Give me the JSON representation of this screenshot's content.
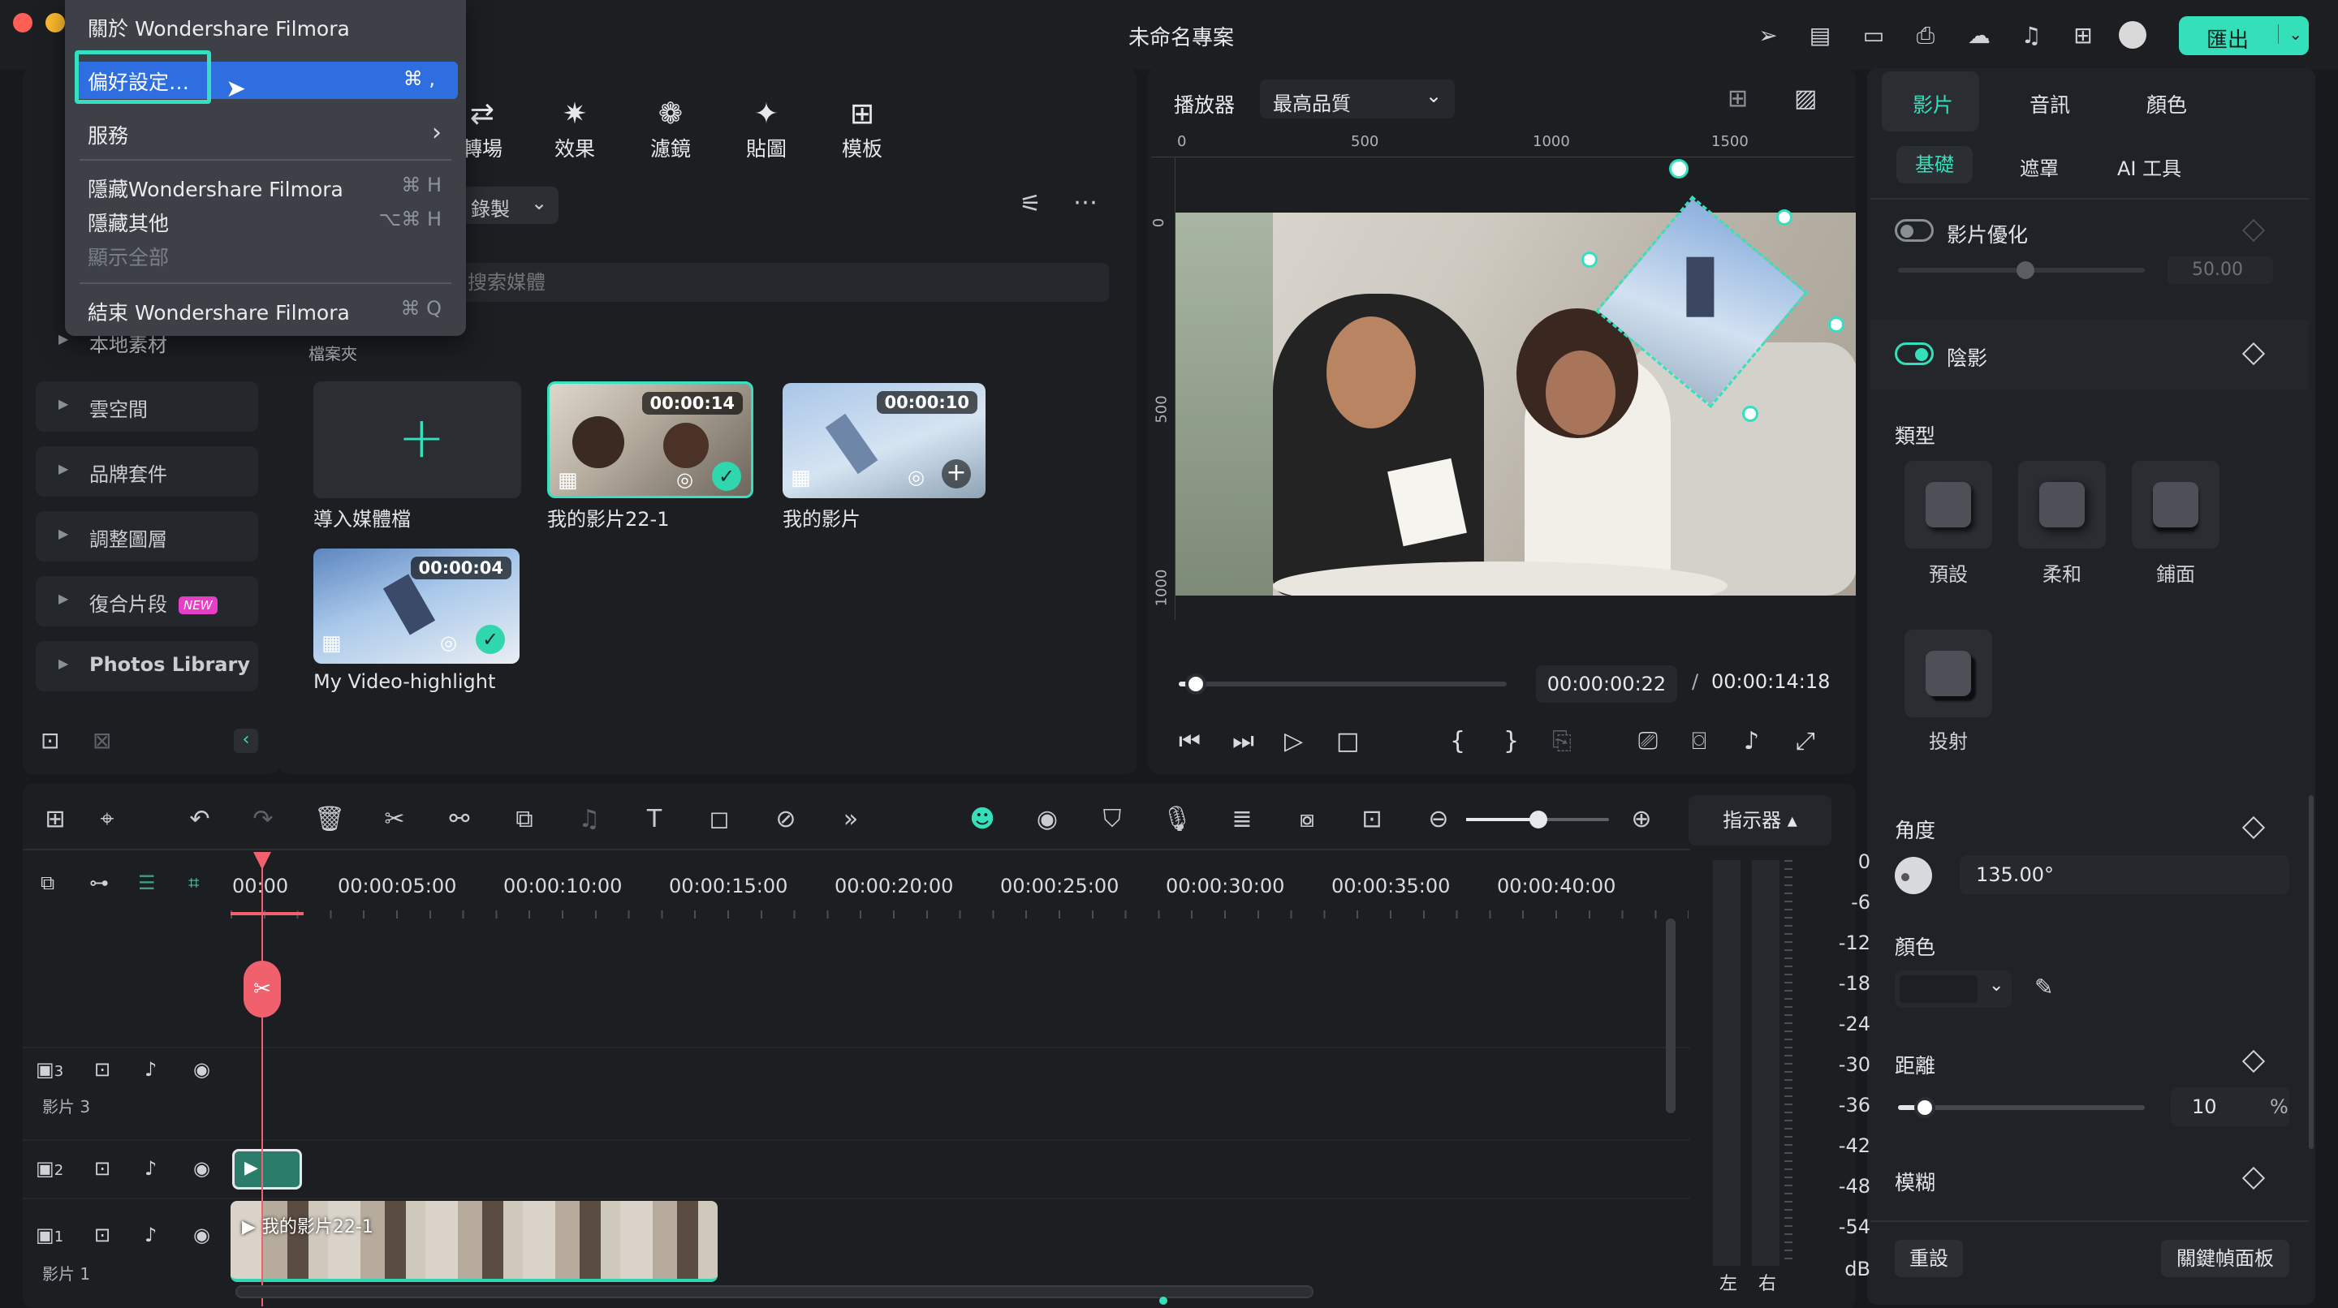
{
  "window": {
    "title": "未命名專案",
    "export_label": "匯出"
  },
  "menu": {
    "items": [
      {
        "label": "關於 Wondershare Filmora",
        "shortcut": ""
      },
      {
        "label": "偏好設定…",
        "shortcut": "⌘ ,"
      },
      {
        "label": "服務",
        "shortcut": "›"
      },
      {
        "label": "隱藏Wondershare Filmora",
        "shortcut": "⌘ H"
      },
      {
        "label": "隱藏其他",
        "shortcut": "⌥⌘ H"
      },
      {
        "label": "顯示全部",
        "shortcut": ""
      },
      {
        "label": "結束 Wondershare Filmora",
        "shortcut": "⌘ Q"
      }
    ]
  },
  "toolbar_tabs": [
    {
      "label": "轉場",
      "icon": "transition-icon"
    },
    {
      "label": "效果",
      "icon": "effects-icon"
    },
    {
      "label": "濾鏡",
      "icon": "filters-icon"
    },
    {
      "label": "貼圖",
      "icon": "stickers-icon"
    },
    {
      "label": "模板",
      "icon": "templates-icon"
    }
  ],
  "media": {
    "record_label": "錄製",
    "search_placeholder": "搜索媒體",
    "folder_label": "檔案夾",
    "import_label": "導入媒體檔",
    "clips": [
      {
        "name": "我的影片22-1",
        "duration": "00:00:14"
      },
      {
        "name": "我的影片",
        "duration": "00:00:10"
      },
      {
        "name": "My Video-highlight",
        "duration": "00:00:04"
      }
    ]
  },
  "sidebar": {
    "items": [
      {
        "label": "本地素材"
      },
      {
        "label": "雲空間"
      },
      {
        "label": "品牌套件"
      },
      {
        "label": "調整圖層"
      },
      {
        "label": "復合片段",
        "badge": "NEW"
      },
      {
        "label": "Photos Library"
      }
    ]
  },
  "player": {
    "label": "播放器",
    "quality": "最高品質",
    "ruler_h": [
      "0",
      "500",
      "1000",
      "1500"
    ],
    "ruler_v": [
      "0",
      "500",
      "1000"
    ],
    "current_time": "00:00:00:22",
    "separator": "/",
    "total_time": "00:00:14:18",
    "progress": 0.03
  },
  "right_panel": {
    "tabs": [
      "影片",
      "音訊",
      "顏色"
    ],
    "subtabs": [
      "基礎",
      "遮罩",
      "AI 工具"
    ],
    "video_enhance": {
      "label": "影片優化",
      "value": "50.00"
    },
    "shadow": {
      "label": "陰影",
      "enabled": true
    },
    "type_label": "類型",
    "types": [
      "預設",
      "柔和",
      "鋪面",
      "投射"
    ],
    "angle": {
      "label": "角度",
      "value": "135.00°"
    },
    "color_label": "顏色",
    "distance": {
      "label": "距離",
      "value": "10",
      "unit": "%",
      "level": 0.08
    },
    "blur_label": "模糊",
    "reset_label": "重設",
    "keyframe_label": "關鍵幀面板"
  },
  "timeline": {
    "timecodes": [
      "00:00",
      "00:00:05:00",
      "00:00:10:00",
      "00:00:15:00",
      "00:00:20:00",
      "00:00:25:00",
      "00:00:30:00",
      "00:00:35:00",
      "00:00:40:00"
    ],
    "indicator_label": "指示器 ▴",
    "meter_scale": [
      "0",
      "-6",
      "-12",
      "-18",
      "-24",
      "-30",
      "-36",
      "-42",
      "-48",
      "-54",
      "dB"
    ],
    "meter_lr": [
      "左",
      "右"
    ],
    "tracks": [
      {
        "num": "3",
        "name": "影片 3"
      },
      {
        "num": "2",
        "name": ""
      },
      {
        "num": "1",
        "name": "影片 1"
      }
    ],
    "clip_label": "我的影片22-1"
  },
  "colors": {
    "accent": "#33e0b9",
    "playhead": "#f0616d",
    "menu_highlight": "#2f6ee0",
    "selection_outline": "#35e0c0"
  }
}
